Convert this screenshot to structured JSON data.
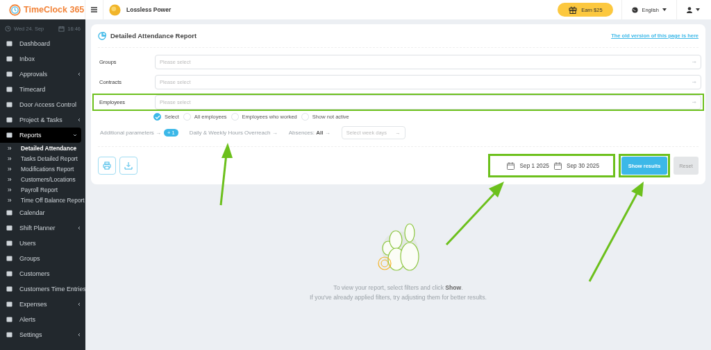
{
  "brand": {
    "name": "TimeClock 365"
  },
  "header": {
    "company": "Lossless Power",
    "earn_button": "Earn $25",
    "language": "English"
  },
  "sidebar": {
    "date": "Wed 24. Sep",
    "time": "16:46",
    "items": [
      {
        "label": "Dashboard",
        "selected": false
      },
      {
        "label": "Inbox",
        "selected": false
      },
      {
        "label": "Approvals",
        "selected": false,
        "expanded": false
      },
      {
        "label": "Timecard",
        "selected": false
      },
      {
        "label": "Door Access Control",
        "selected": false
      },
      {
        "label": "Project & Tasks",
        "selected": false,
        "expanded": false
      },
      {
        "label": "Reports",
        "selected": true,
        "expanded": true,
        "children": [
          {
            "label": "Detailed Attendance",
            "selected": true
          },
          {
            "label": "Tasks Detailed Report",
            "selected": false
          },
          {
            "label": "Modifications Report",
            "selected": false
          },
          {
            "label": "Customers/Locations",
            "selected": false
          },
          {
            "label": "Payroll Report",
            "selected": false
          },
          {
            "label": "Time Off Balance Report",
            "selected": false
          }
        ]
      },
      {
        "label": "Calendar",
        "selected": false
      },
      {
        "label": "Shift Planner",
        "selected": false,
        "expanded": false
      },
      {
        "label": "Users",
        "selected": false
      },
      {
        "label": "Groups",
        "selected": false
      },
      {
        "label": "Customers",
        "selected": false
      },
      {
        "label": "Customers Time Entries",
        "selected": false
      },
      {
        "label": "Expenses",
        "selected": false,
        "expanded": false
      },
      {
        "label": "Alerts",
        "selected": false
      },
      {
        "label": "Settings",
        "selected": false,
        "expanded": false
      }
    ]
  },
  "report": {
    "title": "Detailed Attendance Report",
    "old_version_link": "The old version of this page is here",
    "filters": [
      {
        "label": "Groups",
        "placeholder": "Please select",
        "highlighted": false
      },
      {
        "label": "Contracts",
        "placeholder": "Please select",
        "highlighted": false
      },
      {
        "label": "Employees",
        "placeholder": "Please select",
        "highlighted": true
      }
    ],
    "employee_options": [
      {
        "label": "Select",
        "selected": true
      },
      {
        "label": "All employees",
        "selected": false
      },
      {
        "label": "Employees who worked",
        "selected": false
      },
      {
        "label": "Show not active",
        "selected": false
      }
    ],
    "parameters": [
      {
        "kind": "link",
        "label": "Additional parameters →",
        "badge": "+ 1"
      },
      {
        "kind": "link",
        "label": "Daily & Weekly Hours Overreach →"
      },
      {
        "kind": "link",
        "label": "Absences: **All** →"
      },
      {
        "kind": "select",
        "placeholder": "Select week days",
        "arrow": "→"
      }
    ],
    "date_range": {
      "start": "Sep 1 2025",
      "end": "Sep 30 2025",
      "highlighted": true
    },
    "show_button": {
      "label": "Show results",
      "highlighted": true
    },
    "reset_button": {
      "label": "Reset",
      "disabled": true
    }
  },
  "empty_state": {
    "text": "To view your report, select filters and click **Show**.",
    "hint": "If you've already applied filters, try adjusting them for better results."
  }
}
